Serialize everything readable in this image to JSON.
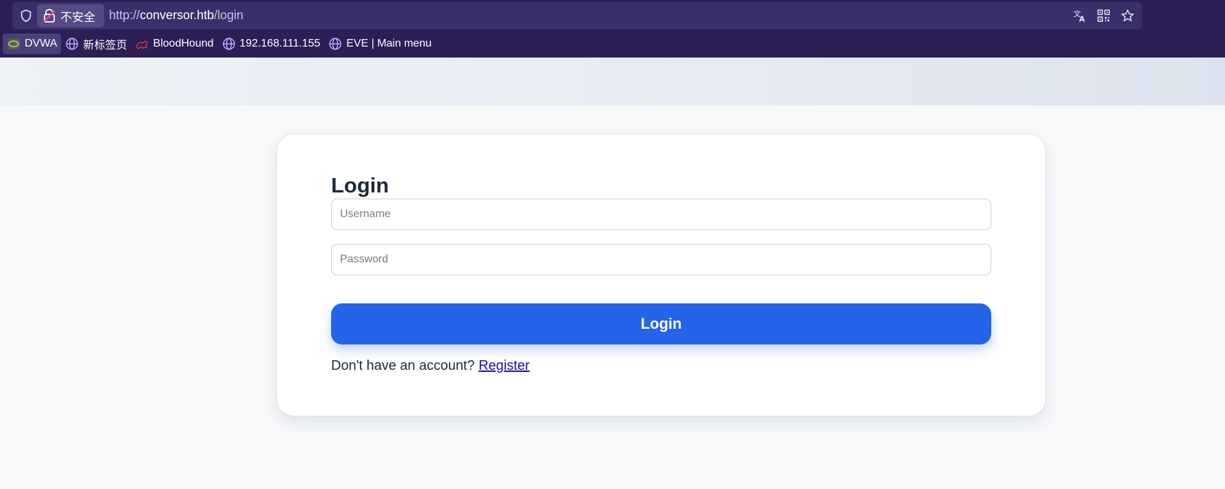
{
  "browser": {
    "security_label": "不安全",
    "url_scheme": "http://",
    "url_host": "conversor.htb",
    "url_path": "/login",
    "icons": [
      "shield-icon",
      "insecure-lock-icon",
      "translate-icon",
      "qr-code-icon",
      "bookmark-star-icon"
    ]
  },
  "bookmarks": [
    {
      "label": "DVWA",
      "icon": "dvwa-icon"
    },
    {
      "label": "新标签页",
      "icon": "globe-icon"
    },
    {
      "label": "BloodHound",
      "icon": "bloodhound-icon"
    },
    {
      "label": "192.168.111.155",
      "icon": "globe-icon"
    },
    {
      "label": "EVE | Main menu",
      "icon": "globe-icon"
    }
  ],
  "login": {
    "title": "Login",
    "username_placeholder": "Username",
    "username_value": "",
    "password_placeholder": "Password",
    "password_value": "",
    "submit_label": "Login",
    "register_prompt": "Don't have an account?",
    "register_link": "Register"
  },
  "colors": {
    "chrome_bg": "#2b1f55",
    "primary_button": "#2563e8",
    "link": "#1a0dab"
  }
}
